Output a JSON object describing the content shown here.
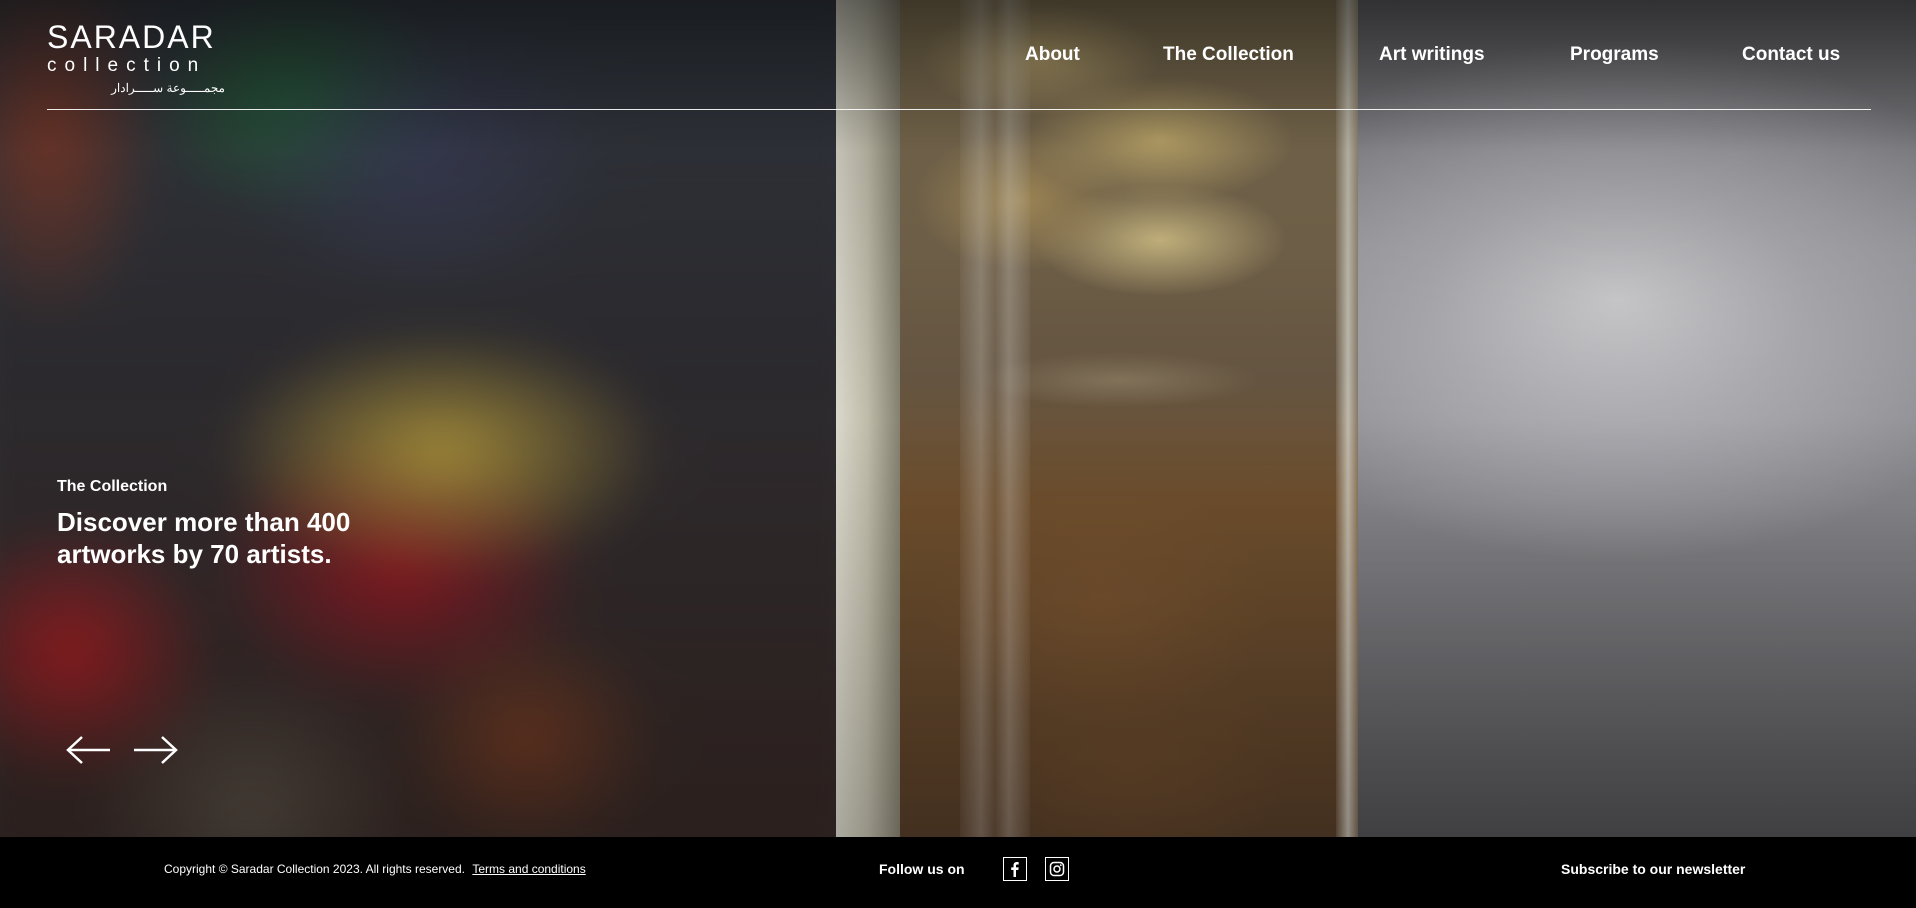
{
  "logo": {
    "main": "SARADAR",
    "sub": "collection",
    "arabic": "مجمـــــوعة ســـــرادار"
  },
  "nav": {
    "items": [
      {
        "label": "About"
      },
      {
        "label": "The Collection"
      },
      {
        "label": "Art writings"
      },
      {
        "label": "Programs"
      },
      {
        "label": "Contact us"
      }
    ]
  },
  "hero": {
    "kicker": "The Collection",
    "headline": "Discover more than 400 artworks by 70 artists.",
    "prev_icon": "arrow-left-icon",
    "next_icon": "arrow-right-icon"
  },
  "footer": {
    "copyright": "Copyright © Saradar Collection 2023. All rights reserved.",
    "terms_link": "Terms and conditions",
    "follow_label": "Follow us on",
    "social": [
      {
        "icon": "facebook-icon"
      },
      {
        "icon": "instagram-icon"
      }
    ],
    "subscribe_label": "Subscribe to our newsletter"
  },
  "colors": {
    "text": "#ffffff",
    "footer_bg": "#000000"
  }
}
